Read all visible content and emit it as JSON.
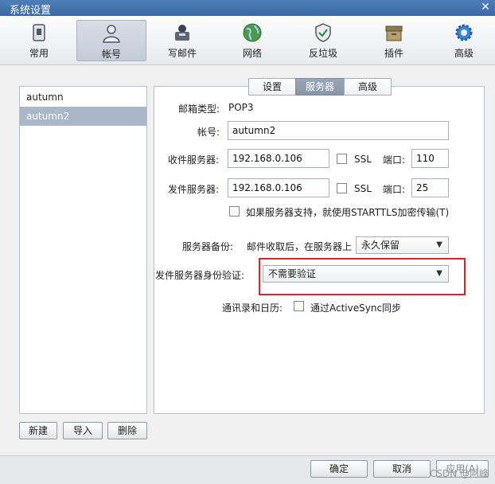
{
  "window": {
    "title": "系统设置"
  },
  "toolbar": {
    "items": [
      {
        "label": "常用",
        "icon": "settings-device-icon"
      },
      {
        "label": "帐号",
        "icon": "user-icon"
      },
      {
        "label": "写邮件",
        "icon": "compose-icon"
      },
      {
        "label": "网络",
        "icon": "globe-icon"
      },
      {
        "label": "反垃圾",
        "icon": "shield-icon"
      },
      {
        "label": "插件",
        "icon": "box-icon"
      },
      {
        "label": "高级",
        "icon": "gear-icon"
      }
    ],
    "active": "帐号"
  },
  "accounts": {
    "items": [
      "autumn",
      "autumn2"
    ],
    "selected": "autumn2",
    "buttons": {
      "new": "新建",
      "import": "导入",
      "delete": "删除"
    }
  },
  "tabs": {
    "items": [
      "设置",
      "服务器",
      "高级"
    ],
    "active": "服务器"
  },
  "server": {
    "mail_type_label": "邮箱类型:",
    "mail_type_value": "POP3",
    "account_label": "帐号:",
    "account_value": "autumn2",
    "incoming_label": "收件服务器:",
    "incoming_value": "192.168.0.106",
    "incoming_ssl": "SSL",
    "incoming_port_label": "端口:",
    "incoming_port": "110",
    "outgoing_label": "发件服务器:",
    "outgoing_value": "192.168.0.106",
    "outgoing_ssl": "SSL",
    "outgoing_port_label": "端口:",
    "outgoing_port": "25",
    "starttls_text": "如果服务器支持，就使用STARTTLS加密传输(T)",
    "backup_label": "服务器备份:",
    "backup_text": "邮件收取后，在服务器上",
    "backup_select": "永久保留",
    "auth_label": "发件服务器身份验证:",
    "auth_select": "不需要验证",
    "sync_label": "通讯录和日历:",
    "sync_text": "通过ActiveSync同步"
  },
  "footer": {
    "ok": "确定",
    "cancel": "取消",
    "apply": "应用(A)",
    "watermark": "CSDN @阿峰"
  },
  "colors": {
    "titlebar": "#3a69a5",
    "highlight": "#d62828",
    "selected_row": "#a9b7c9"
  }
}
